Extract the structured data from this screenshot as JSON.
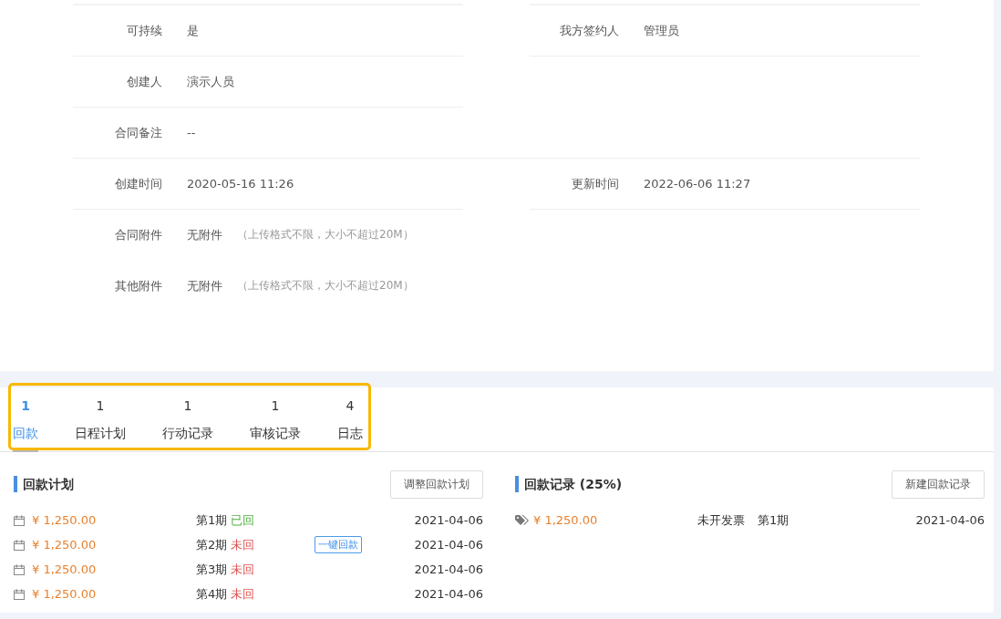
{
  "details": [
    {
      "kind": "pair",
      "divider": true,
      "cells": [
        {
          "label": "可持续",
          "value": "是"
        },
        {
          "label": "我方签约人",
          "value": "管理员"
        }
      ]
    },
    {
      "kind": "pair",
      "divider": true,
      "cells": [
        {
          "label": "创建人",
          "value": "演示人员"
        }
      ]
    },
    {
      "kind": "wide",
      "divider": true,
      "cells": [
        {
          "label": "合同备注",
          "value": "--"
        }
      ]
    },
    {
      "kind": "pair",
      "divider": true,
      "cells": [
        {
          "label": "创建时间",
          "value": "2020-05-16 11:26"
        },
        {
          "label": "更新时间",
          "value": "2022-06-06 11:27"
        }
      ]
    },
    {
      "kind": "pair",
      "divider": false,
      "cells": [
        {
          "label": "合同附件",
          "value": "无附件",
          "note": "（上传格式不限，大小不超过20M）"
        }
      ]
    },
    {
      "kind": "pair",
      "divider": false,
      "cells": [
        {
          "label": "其他附件",
          "value": "无附件",
          "note": "（上传格式不限，大小不超过20M）"
        }
      ]
    }
  ],
  "tabs": [
    {
      "count": "1",
      "label": "回款",
      "selected": true
    },
    {
      "count": "1",
      "label": "日程计划",
      "selected": false
    },
    {
      "count": "1",
      "label": "行动记录",
      "selected": false
    },
    {
      "count": "1",
      "label": "审核记录",
      "selected": false
    },
    {
      "count": "4",
      "label": "日志",
      "selected": false
    }
  ],
  "plan": {
    "title": "回款计划",
    "button": "调整回款计划",
    "rows": [
      {
        "amount": "¥ 1,250.00",
        "period": "第1期",
        "status": "已回",
        "returned": true,
        "date": "2021-04-06"
      },
      {
        "amount": "¥ 1,250.00",
        "period": "第2期",
        "status": "未回",
        "returned": false,
        "action": "一键回款",
        "date": "2021-04-06"
      },
      {
        "amount": "¥ 1,250.00",
        "period": "第3期",
        "status": "未回",
        "returned": false,
        "date": "2021-04-06"
      },
      {
        "amount": "¥ 1,250.00",
        "period": "第4期",
        "status": "未回",
        "returned": false,
        "date": "2021-04-06"
      }
    ]
  },
  "records": {
    "title": "回款记录 (25%)",
    "button": "新建回款记录",
    "rows": [
      {
        "amount": "¥ 1,250.00",
        "invoice": "未开发票",
        "period": "第1期",
        "date": "2021-04-06"
      }
    ]
  }
}
